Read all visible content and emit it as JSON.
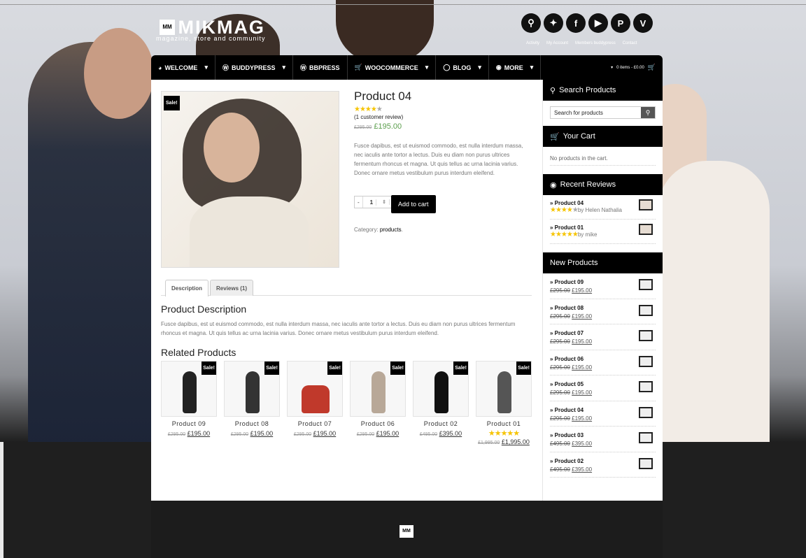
{
  "header": {
    "logo_mark": "MM",
    "logo_text": "MIKMAG",
    "tagline": "magazine, store and community",
    "social_icons": [
      "search-icon",
      "twitter-icon",
      "facebook-icon",
      "youtube-icon",
      "pinterest-icon",
      "vimeo-icon"
    ],
    "social_glyphs": [
      "⚲",
      "✦",
      "f",
      "▶",
      "P",
      "V"
    ],
    "top_links": [
      "Activity",
      "My Account",
      "Members buddypress",
      "Contact"
    ]
  },
  "nav": {
    "items": [
      {
        "icon": "◕",
        "label": "WELCOME",
        "caret": "▾"
      },
      {
        "icon": "Ⓦ",
        "label": "BUDDYPRESS",
        "caret": "▾"
      },
      {
        "icon": "Ⓦ",
        "label": "BBPRESS",
        "caret": ""
      },
      {
        "icon": "🛒",
        "label": "WOOCOMMERCE",
        "caret": "▾"
      },
      {
        "icon": "◯",
        "label": "BLOG",
        "caret": "▾"
      },
      {
        "icon": "◉",
        "label": "MORE",
        "caret": "▾"
      }
    ],
    "cart_summary": "0 items - £0.00"
  },
  "product": {
    "sale_badge": "Sale!",
    "title": "Product 04",
    "review_count": "(1 customer review)",
    "old_price": "£295.00",
    "new_price": "£195.00",
    "description": "Fusce dapibus, est ut euismod commodo, est nulla interdum massa, nec iaculis ante tortor a lectus. Duis eu diam non purus ultrices fermentum rhoncus et magna. Ut quis tellus ac urna lacinia varius. Donec ornare metus vestibulum purus interdum eleifend.",
    "qty_minus": "-",
    "qty_value": "1",
    "qty_plus": "+",
    "add_to_cart": "Add to cart",
    "category_label": "Category:",
    "category_value": "products"
  },
  "tabs": [
    "Description",
    "Reviews (1)"
  ],
  "description_section": {
    "heading": "Product Description",
    "text": "Fusce dapibus, est ut euismod commodo, est nulla interdum massa, nec iaculis ante tortor a lectus. Duis eu diam non purus ultrices fermentum rhoncus et magna. Ut quis tellus ac urna lacinia varius. Donec ornare metus vestibulum purus interdum eleifend."
  },
  "related": {
    "heading": "Related Products",
    "items": [
      {
        "name": "Product 09",
        "old": "£295.00",
        "new": "£195.00",
        "sale": "Sale!",
        "stars": "",
        "color": "#222"
      },
      {
        "name": "Product 08",
        "old": "£295.00",
        "new": "£195.00",
        "sale": "Sale!",
        "stars": "",
        "color": "#333"
      },
      {
        "name": "Product 07",
        "old": "£295.00",
        "new": "£195.00",
        "sale": "Sale!",
        "stars": "",
        "color": "#c0392b"
      },
      {
        "name": "Product 06",
        "old": "£295.00",
        "new": "£195.00",
        "sale": "Sale!",
        "stars": "",
        "color": "#b8a898"
      },
      {
        "name": "Product 02",
        "old": "£495.00",
        "new": "£395.00",
        "sale": "Sale!",
        "stars": "",
        "color": "#111"
      },
      {
        "name": "Product 01",
        "old": "£1,995.00",
        "new": "£1,995.00",
        "sale": "Sale!",
        "stars": "★★★★★",
        "color": "#555"
      }
    ]
  },
  "sidebar": {
    "search_title": "Search Products",
    "search_placeholder": "Search for products",
    "cart_title": "Your Cart",
    "cart_empty": "No products in the cart.",
    "reviews_title": "Recent Reviews",
    "reviews": [
      {
        "title": "» Product 04",
        "by": "by Helen Nathalia",
        "stars": "★★★★",
        "off": "★"
      },
      {
        "title": "» Product 01",
        "by": "by mike",
        "stars": "★★★★★",
        "off": ""
      }
    ],
    "new_products_title": "New Products",
    "new_products": [
      {
        "title": "» Product 09",
        "old": "£295.00",
        "new": "£195.00"
      },
      {
        "title": "» Product 08",
        "old": "£295.00",
        "new": "£195.00"
      },
      {
        "title": "» Product 07",
        "old": "£295.00",
        "new": "£195.00"
      },
      {
        "title": "» Product 06",
        "old": "£295.00",
        "new": "£195.00"
      },
      {
        "title": "» Product 05",
        "old": "£295.00",
        "new": "£195.00"
      },
      {
        "title": "» Product 04",
        "old": "£295.00",
        "new": "£195.00"
      },
      {
        "title": "» Product 03",
        "old": "£495.00",
        "new": "£395.00"
      },
      {
        "title": "» Product 02",
        "old": "£495.00",
        "new": "£395.00"
      }
    ]
  },
  "footer": {
    "mark": "MM"
  }
}
